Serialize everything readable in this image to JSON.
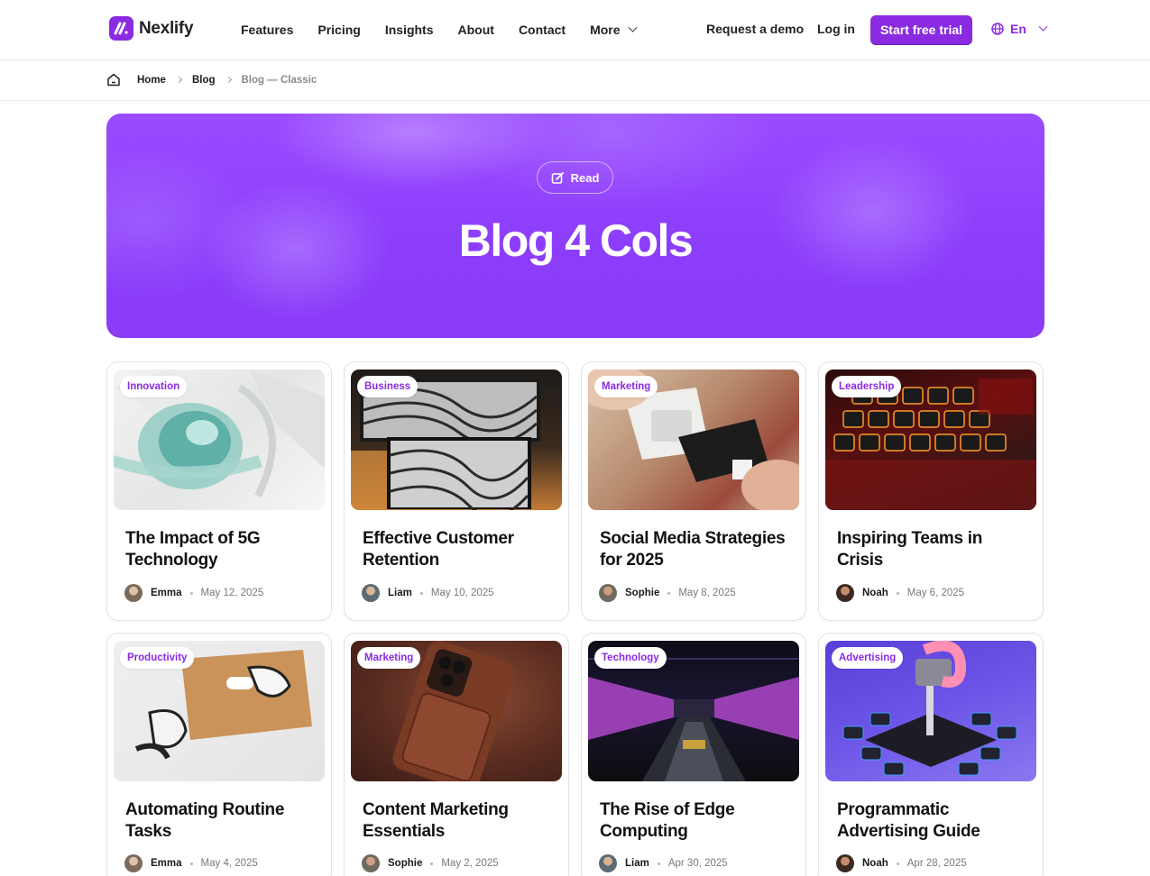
{
  "brand": {
    "name": "Nexlify",
    "accent": "#8a2be2"
  },
  "nav": {
    "items": [
      "Features",
      "Pricing",
      "Insights",
      "About",
      "Contact",
      "More"
    ],
    "request_demo": "Request a demo",
    "login": "Log in",
    "trial": "Start free trial",
    "language": "En"
  },
  "breadcrumb": {
    "home": "Home",
    "blog": "Blog",
    "current": "Blog — Classic"
  },
  "hero": {
    "badge": "Read",
    "title": "Blog 4 Cols"
  },
  "cards": [
    {
      "tag": "Innovation",
      "title": "The Impact of 5G Technology",
      "author": "Emma",
      "date": "May 12, 2025"
    },
    {
      "tag": "Business",
      "title": "Effective Customer Retention",
      "author": "Liam",
      "date": "May 10, 2025"
    },
    {
      "tag": "Marketing",
      "title": "Social Media Strategies for 2025",
      "author": "Sophie",
      "date": "May 8, 2025"
    },
    {
      "tag": "Leadership",
      "title": "Inspiring Teams in Crisis",
      "author": "Noah",
      "date": "May 6, 2025"
    },
    {
      "tag": "Productivity",
      "title": "Automating Routine Tasks",
      "author": "Emma",
      "date": "May 4, 2025"
    },
    {
      "tag": "Marketing",
      "title": "Content Marketing Essentials",
      "author": "Sophie",
      "date": "May 2, 2025"
    },
    {
      "tag": "Technology",
      "title": "The Rise of Edge Computing",
      "author": "Liam",
      "date": "Apr 30, 2025"
    },
    {
      "tag": "Advertising",
      "title": "Programmatic Advertising Guide",
      "author": "Noah",
      "date": "Apr 28, 2025"
    }
  ]
}
